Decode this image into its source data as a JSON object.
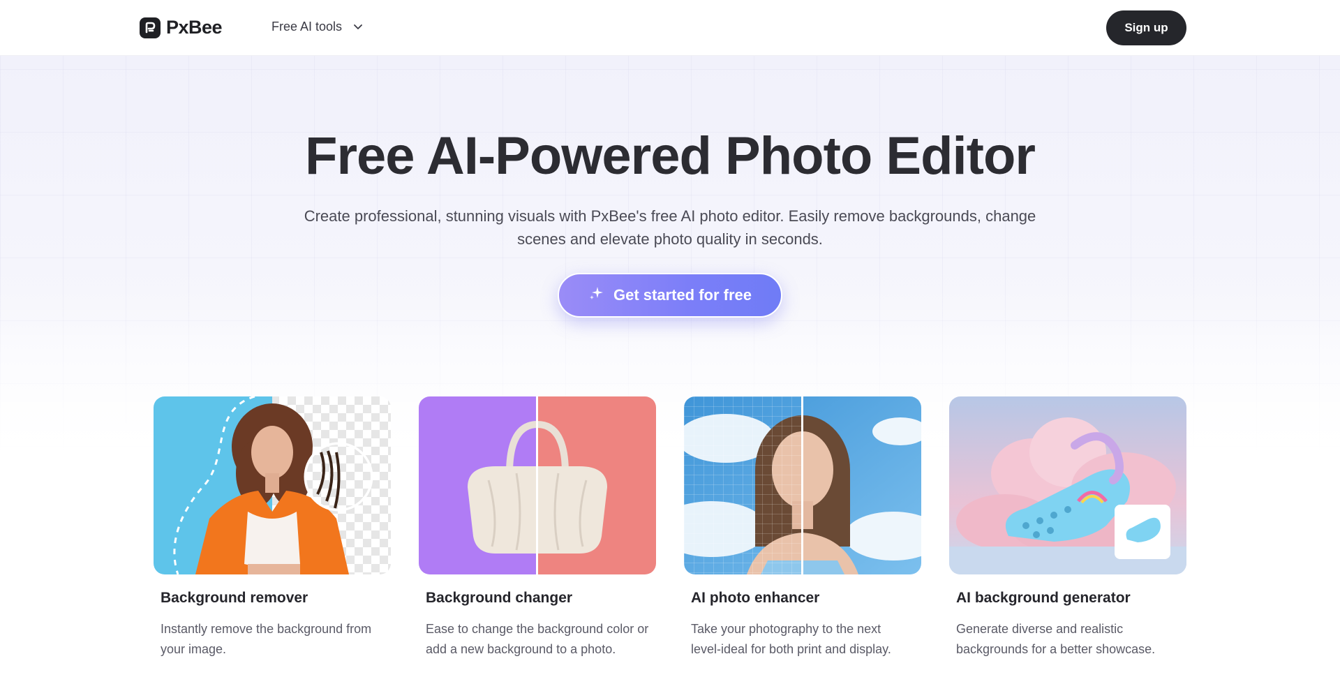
{
  "header": {
    "brand": "PxBee",
    "nav_tools_label": "Free AI tools",
    "signup_label": "Sign up"
  },
  "hero": {
    "title": "Free AI-Powered Photo Editor",
    "subtitle_line1": "Create professional, stunning visuals with PxBee's free AI photo editor. Easily remove backgrounds, change",
    "subtitle_line2": "scenes and elevate photo quality in seconds.",
    "cta_label": "Get started for free"
  },
  "cards": [
    {
      "title": "Background remover",
      "desc": "Instantly remove the background from your image."
    },
    {
      "title": "Background changer",
      "desc": "Ease to change the background color or add a new background to a photo."
    },
    {
      "title": "AI photo enhancer",
      "desc": "Take your photography to the next level-ideal for both print and display."
    },
    {
      "title": "AI background generator",
      "desc": "Generate diverse and realistic backgrounds for a better showcase."
    }
  ],
  "colors": {
    "cta_gradient_start": "#9a8cf7",
    "cta_gradient_end": "#6f7cf6",
    "signup_bg": "#25262b",
    "changer_left": "#b07cf5",
    "changer_right": "#ee8480"
  },
  "icons": [
    "logo-icon",
    "chevron-down-icon",
    "sparkle-icon"
  ]
}
